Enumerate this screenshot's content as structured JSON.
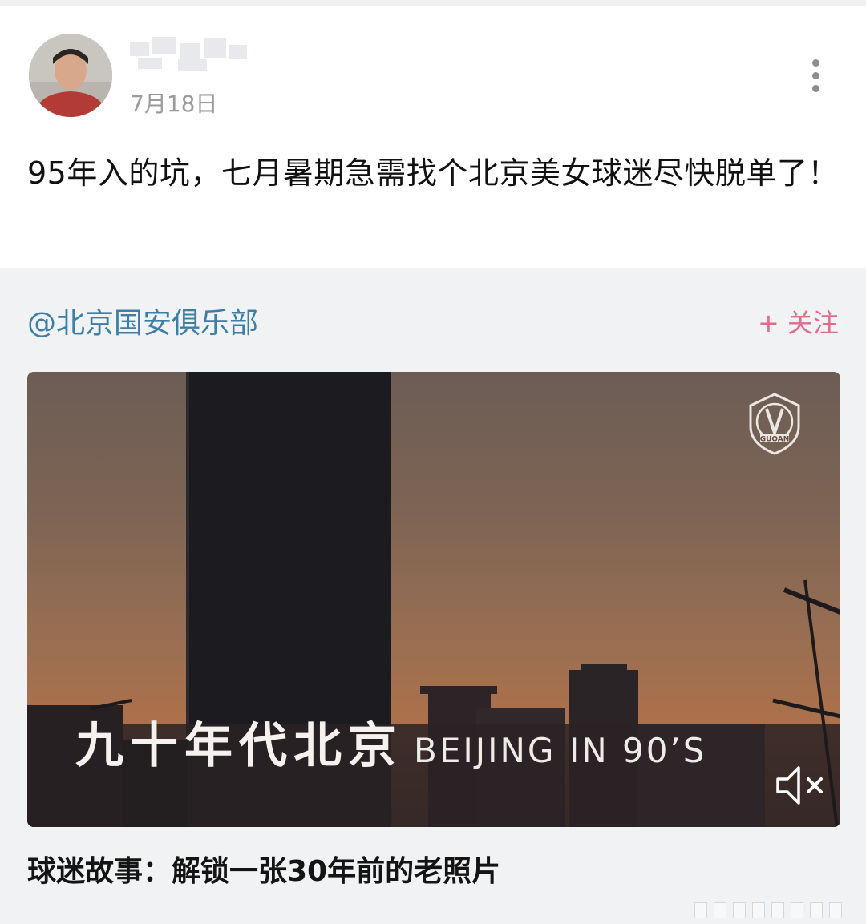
{
  "post": {
    "date": "7月18日",
    "text": "95年入的坑，七月暑期急需找个北京美女球迷尽快脱单了！"
  },
  "repost": {
    "mention": "@北京国安俱乐部",
    "follow_label": "+ 关注",
    "video": {
      "title_cn": "九十年代北京",
      "title_en": "BEIJING IN 90’S",
      "logo_text": "GUOAN",
      "muted": true
    },
    "caption": "球迷故事：解锁一张30年前的老照片"
  },
  "icons": {
    "more": "more-vertical-icon",
    "mute": "speaker-muted-icon",
    "logo": "guoan-club-logo"
  },
  "colors": {
    "mention": "#3d7ea6",
    "follow": "#e26a8b",
    "date": "#9a9a9a",
    "repost_background": "#f1f2f4"
  }
}
